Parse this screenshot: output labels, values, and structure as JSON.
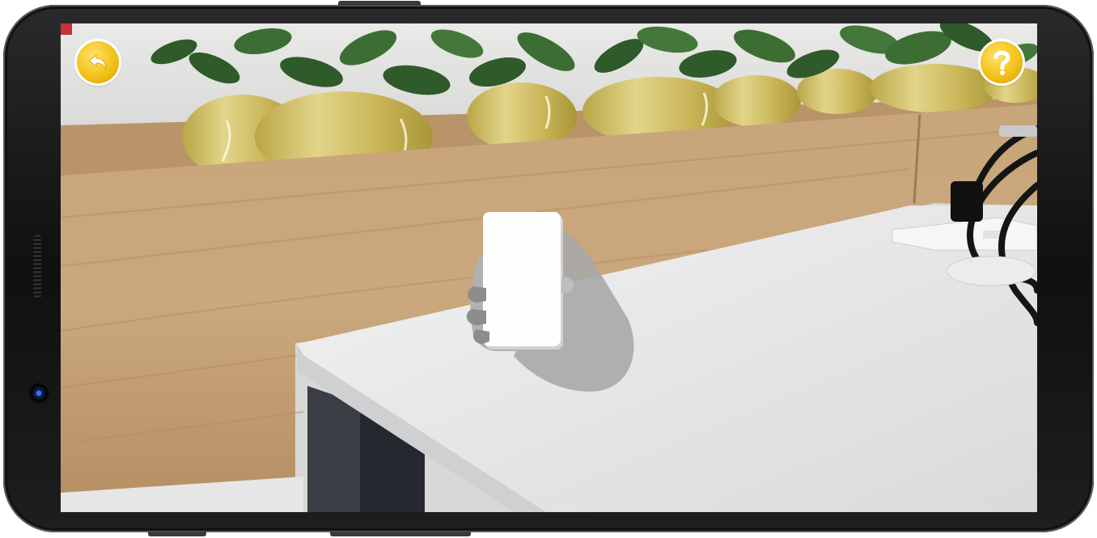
{
  "device": {
    "model": "android-phone-landscape"
  },
  "scene": {
    "description_icon": "camera-feed"
  },
  "toolbar": {
    "back_icon": "back-arrow-icon",
    "help_icon": "question-mark-icon",
    "accent_color": "#f2c21a"
  },
  "hint": {
    "icon": "hand-holding-phone-icon"
  }
}
